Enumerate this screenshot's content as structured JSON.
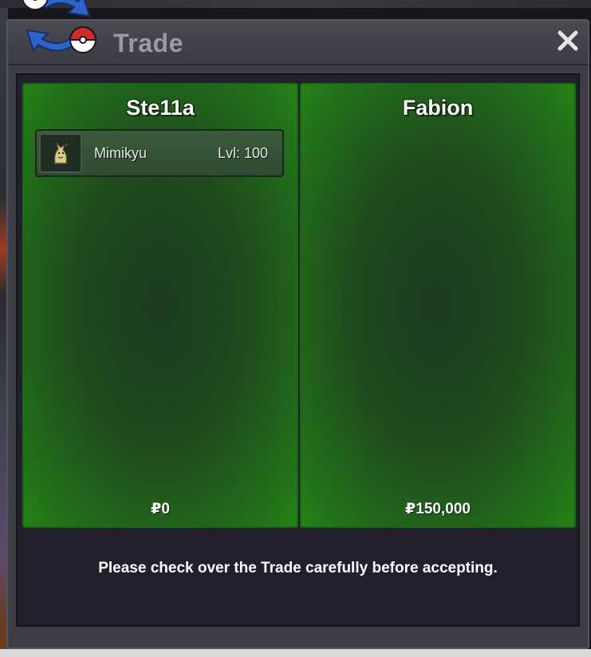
{
  "window": {
    "title": "Trade",
    "close_icon": "close-icon",
    "logo_icon": "trade-swap-pokeball-icon"
  },
  "trade": {
    "left": {
      "player_name": "Ste11a",
      "items": [
        {
          "pokemon": "Mimikyu",
          "level": "Lvl: 100",
          "icon": "mimikyu-sprite-icon"
        }
      ],
      "money": "₽0"
    },
    "right": {
      "player_name": "Fabion",
      "items": [],
      "money": "₽150,000"
    }
  },
  "notice": "Please check over the Trade carefully before accepting.",
  "colors": {
    "panel_green": "#268316",
    "content_bg": "#23202e",
    "window_bg": "#3d3d45",
    "title_text": "#9a9aa2"
  }
}
